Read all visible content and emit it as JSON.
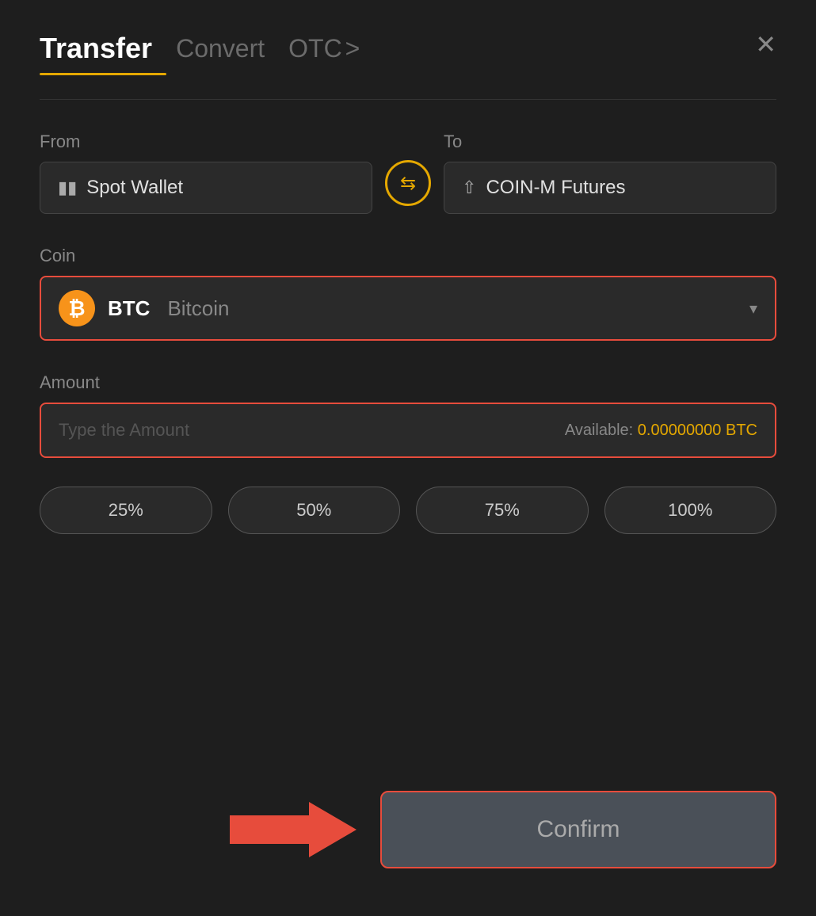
{
  "header": {
    "tab_transfer": "Transfer",
    "tab_convert": "Convert",
    "tab_otc": "OTC",
    "tab_otc_chevron": ">",
    "close_label": "✕"
  },
  "from": {
    "label": "From",
    "wallet_icon": "▬",
    "wallet_name": "Spot Wallet"
  },
  "swap": {
    "icon": "⇄"
  },
  "to": {
    "label": "To",
    "wallet_icon": "↑",
    "wallet_name": "COIN-M Futures"
  },
  "coin": {
    "label": "Coin",
    "name": "BTC",
    "full_name": "Bitcoin",
    "chevron": "▾"
  },
  "amount": {
    "label": "Amount",
    "placeholder": "Type the Amount",
    "available_label": "Available:",
    "available_value": "0.00000000 BTC"
  },
  "percent_buttons": [
    {
      "label": "25%"
    },
    {
      "label": "50%"
    },
    {
      "label": "75%"
    },
    {
      "label": "100%"
    }
  ],
  "confirm_button": "Confirm"
}
